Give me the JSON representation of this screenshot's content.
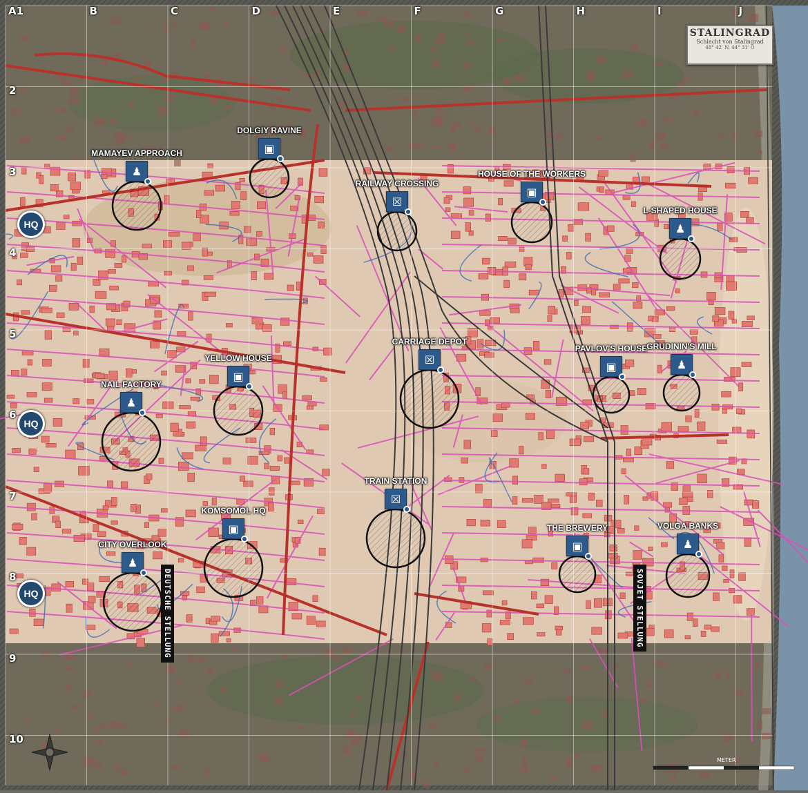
{
  "map_title": {
    "title": "STALINGRAD",
    "subtitle": "Schlacht von Stalingrad",
    "coords": "48° 42' N, 44° 31' O"
  },
  "grid": {
    "columns": [
      "A1",
      "B",
      "C",
      "D",
      "E",
      "F",
      "G",
      "H",
      "I",
      "J"
    ],
    "rows": [
      "2",
      "3",
      "4",
      "5",
      "6",
      "7",
      "8",
      "9",
      "10"
    ]
  },
  "objectives": [
    {
      "name": "MAMAYEV APPROACH",
      "icon": "infantry-icon"
    },
    {
      "name": "DOLGIY RAVINE",
      "icon": "supply-icon"
    },
    {
      "name": "RAILWAY CROSSING",
      "icon": "explosive-icon"
    },
    {
      "name": "HOUSE OF THE WORKERS",
      "icon": "supply-icon"
    },
    {
      "name": "L-SHAPED HOUSE",
      "icon": "infantry-icon"
    },
    {
      "name": "CARRIAGE DEPOT",
      "icon": "explosive-icon"
    },
    {
      "name": "YELLOW HOUSE",
      "icon": "supply-icon"
    },
    {
      "name": "NAIL FACTORY",
      "icon": "infantry-icon"
    },
    {
      "name": "PAVLOV'S HOUSE",
      "icon": "supply-icon"
    },
    {
      "name": "GRUDININ'S MILL",
      "icon": "infantry-icon"
    },
    {
      "name": "TRAIN STATION",
      "icon": "explosive-icon"
    },
    {
      "name": "KOMSOMOL HQ",
      "icon": "supply-icon"
    },
    {
      "name": "CITY OVERLOOK",
      "icon": "infantry-icon"
    },
    {
      "name": "THE BREWERY",
      "icon": "supply-icon"
    },
    {
      "name": "VOLGA BANKS",
      "icon": "infantry-icon"
    }
  ],
  "hq_label": "HQ",
  "front_lines": {
    "german": "DEUTSCHE STELLUNG",
    "soviet": "SOVJET STELLUNG"
  },
  "scale_label": "METER",
  "colors": {
    "road": "#b8322c",
    "street": "#d94fb8",
    "ground": "#e0cbb4",
    "marker": "#2d5a8a",
    "river": "#7b93a8"
  }
}
